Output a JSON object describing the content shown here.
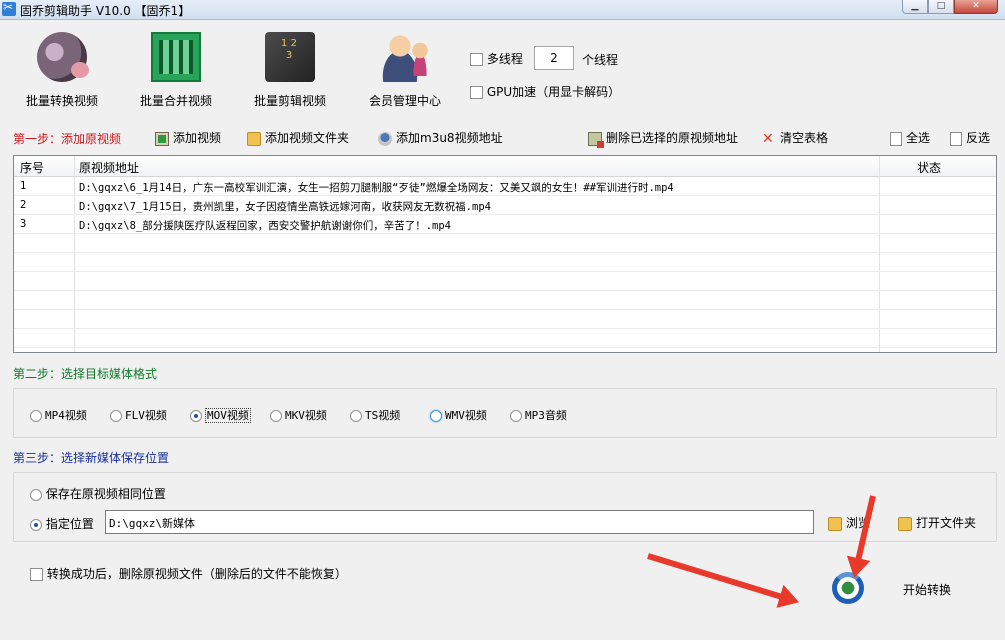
{
  "window": {
    "title": "固乔剪辑助手 V10.0 【固乔1】",
    "controls": [
      "minimize",
      "maximize",
      "close"
    ]
  },
  "toolbar": {
    "tools": [
      {
        "label": "批量转换视频",
        "icon": "film-reel-icon"
      },
      {
        "label": "批量合并视频",
        "icon": "merge-grid-icon"
      },
      {
        "label": "批量剪辑视频",
        "icon": "film-strip-scissors-icon"
      },
      {
        "label": "会员管理中心",
        "icon": "users-icon"
      }
    ],
    "multithread_label": "多线程",
    "multithread_checked": false,
    "thread_count": "2",
    "thread_unit": "个线程",
    "gpu_label": "GPU加速（用显卡解码）",
    "gpu_checked": false
  },
  "step1": {
    "title": "第一步：添加原视频",
    "actions": {
      "add_video": "添加视频",
      "add_folder": "添加视频文件夹",
      "add_m3u8": "添加m3u8视频地址",
      "delete_selected": "删除已选择的原视频地址",
      "clear_table": "清空表格",
      "select_all": "全选",
      "invert": "反选"
    }
  },
  "table": {
    "columns": [
      "序号",
      "原视频地址",
      "状态"
    ],
    "rows": [
      {
        "no": "1",
        "path": "D:\\gqxz\\6_1月14日，广东一高校军训汇演，女生一招剪刀腿制服“歹徒”燃爆全场网友：又美又飒的女生！##军训进行时.mp4",
        "status": ""
      },
      {
        "no": "2",
        "path": "D:\\gqxz\\7_1月15日，贵州凯里，女子因疫情坐高铁远嫁河南，收获网友无数祝福.mp4",
        "status": ""
      },
      {
        "no": "3",
        "path": "D:\\gqxz\\8_部分援陕医疗队返程回家，西安交警护航谢谢你们，辛苦了！.mp4",
        "status": ""
      }
    ]
  },
  "step2": {
    "title": "第二步：选择目标媒体格式",
    "formats": [
      "MP4视频",
      "FLV视频",
      "MOV视频",
      "MKV视频",
      "TS视频",
      "WMV视频",
      "MP3音频"
    ],
    "selected": "MOV视频"
  },
  "step3": {
    "title": "第三步：选择新媒体保存位置",
    "option_same": "保存在原视频相同位置",
    "option_custom": "指定位置",
    "selected": "指定位置",
    "path_value": "D:\\gqxz\\新媒体",
    "browse": "浏览",
    "open_folder": "打开文件夹"
  },
  "footer": {
    "delete_after_label": "转换成功后，删除原视频文件（删除后的文件不能恢复）",
    "delete_after_checked": false,
    "start_label": "开始转换"
  },
  "annotation_color": "#e8392b"
}
